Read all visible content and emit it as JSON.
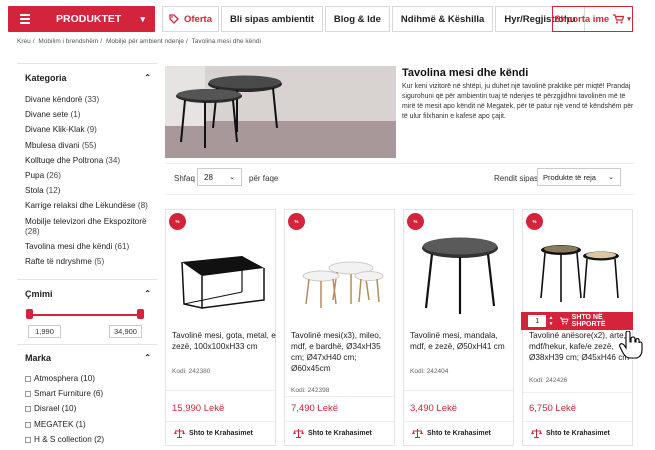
{
  "header": {
    "produktet_label": "PRODUKTET",
    "nav": [
      {
        "label": "Oferta"
      },
      {
        "label": "Bli sipas ambientit"
      },
      {
        "label": "Blog & Ide"
      },
      {
        "label": "Ndihmë & Këshilla"
      },
      {
        "label": "Hyr/Regjistrohu"
      }
    ],
    "cart_label": "Shporta ime"
  },
  "breadcrumb": [
    "Kreu",
    "Mobilim i brendshëm",
    "Mobilje për ambient ndenje",
    "Tavolina mesi dhe këndi"
  ],
  "sidebar": {
    "category_title": "Kategoria",
    "categories": [
      {
        "name": "Divane këndorë",
        "count": "(33)"
      },
      {
        "name": "Divane sete",
        "count": "(1)"
      },
      {
        "name": "Divane Klik-Klak",
        "count": "(9)"
      },
      {
        "name": "Mbulesa divani",
        "count": "(55)"
      },
      {
        "name": "Kolltuqe dhe Poltrona",
        "count": "(34)"
      },
      {
        "name": "Pupa",
        "count": "(26)"
      },
      {
        "name": "Stola",
        "count": "(12)"
      },
      {
        "name": "Karrige relaksi dhe Lëkundëse",
        "count": "(8)"
      },
      {
        "name": "Mobilje televizori dhe Ekspozitorë",
        "count": "(28)"
      },
      {
        "name": "Tavolina mesi dhe këndi",
        "count": "(61)"
      },
      {
        "name": "Rafte të ndryshme",
        "count": "(5)"
      }
    ],
    "price_title": "Çmimi",
    "price_min": "1,990",
    "price_max": "34,900",
    "brand_title": "Marka",
    "brands": [
      {
        "name": "Atmosphera",
        "count": "(10)"
      },
      {
        "name": "Smart Furniture",
        "count": "(6)"
      },
      {
        "name": "Disrael",
        "count": "(10)"
      },
      {
        "name": "MEGATEK",
        "count": "(1)"
      },
      {
        "name": "H & S collection",
        "count": "(2)"
      }
    ]
  },
  "hero": {
    "title": "Tavolina mesi dhe këndi",
    "text": "Kur keni vizitorë në shtëpi, ju duhet një tavolinë praktike për miqtë! Prandaj sigurohuni që për ambientin tuaj të ndenjes të përzgjidhni tavolinën më të mirë të mesit apo këndit në Megatek, për të patur një vend të këndshëm për të ulur filxhanin e kafesë apo çajit."
  },
  "toolbar": {
    "show_label": "Shfaq",
    "show_value": "28",
    "per_page": "për faqe",
    "sort_label": "Rendit sipas",
    "sort_value": "Produkte të reja"
  },
  "products": [
    {
      "name": "Tavolinë mesi, gota, metal, e zezë, 100x100xH33 cm",
      "code": "Kodi: 242380",
      "price": "15,990 Lekë",
      "compare": "Shto te Krahasimet"
    },
    {
      "name": "Tavolinë mesi(x3), mileo, mdf, e bardhë, Ø34xH35 cm; Ø47xH40 cm; Ø60x45cm",
      "code": "Kodi: 242398",
      "price": "7,490 Lekë",
      "compare": "Shto te Krahasimet"
    },
    {
      "name": "Tavolinë mesi, mandala, mdf, e zezë, Ø50xH41 cm",
      "code": "Kodi: 242404",
      "price": "3,490 Lekë",
      "compare": "Shto te Krahasimet"
    },
    {
      "name": "Tavolinë anësore(x2), arte, mdf/hekur, kafe/e zezë, Ø38xH39 cm; Ø45xH46 cm",
      "code": "Kodi: 242426",
      "price": "6,750 Lekë",
      "compare": "Shto te Krahasimet"
    }
  ],
  "add_to_cart": {
    "qty": "1",
    "label": "SHTO NË SHPORTË"
  },
  "colors": {
    "brand_red": "#d4243b",
    "price_red": "#c62a36"
  }
}
